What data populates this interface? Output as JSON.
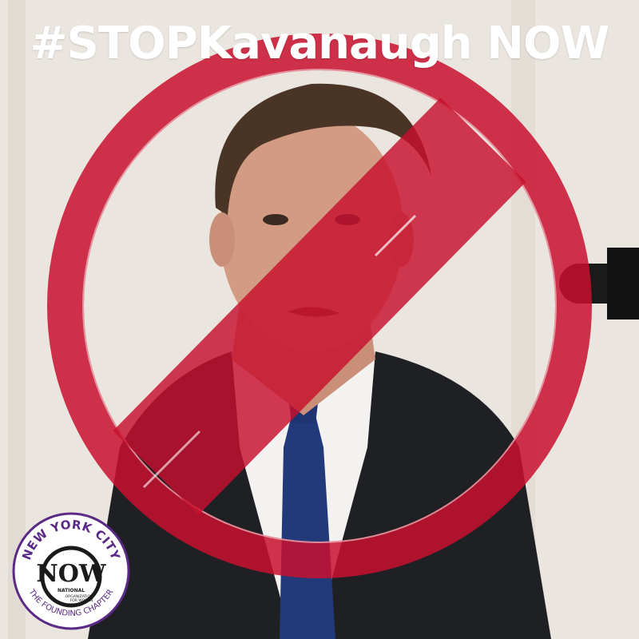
{
  "headline": "#STOPKavanaugh NOW",
  "logo": {
    "top_arc": "NEW YORK CITY",
    "mark": "NOW",
    "national": "NATIONAL",
    "org_line1": "ORGANIZATION",
    "org_line2": "FOR WOMEN",
    "bottom_arc": "THE FOUNDING CHAPTER"
  },
  "colors": {
    "prohibition_red": "#c8102e",
    "logo_purple": "#5b2a86",
    "headline_white": "#ffffff"
  },
  "icons": [
    "prohibition-icon",
    "microphone-icon"
  ]
}
